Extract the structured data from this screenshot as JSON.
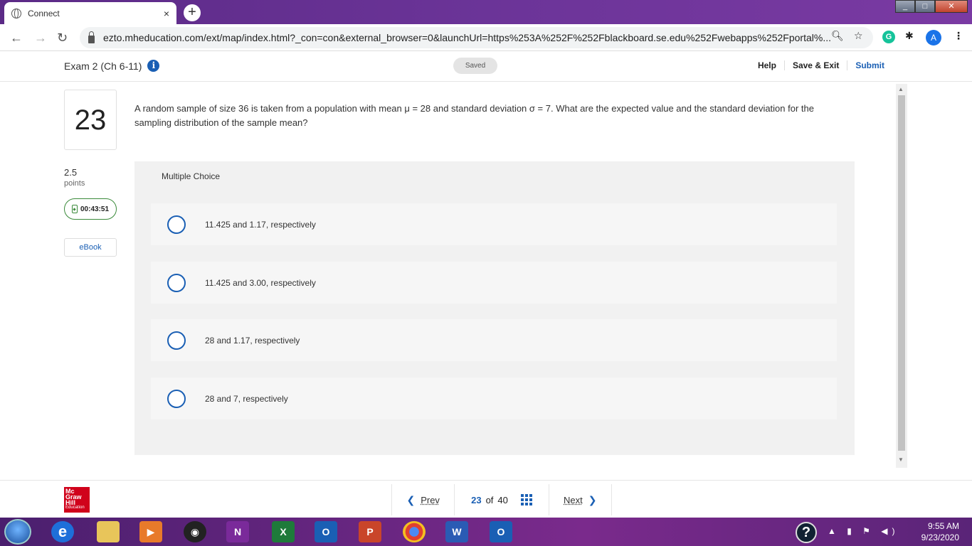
{
  "browser": {
    "tab_title": "Connect",
    "tab_close": "×",
    "new_tab": "+",
    "url": "ezto.mheducation.com/ext/map/index.html?_con=con&external_browser=0&launchUrl=https%253A%252F%252Fblackboard.se.edu%252Fwebapps%252Fportal%...",
    "avatar_letter": "A",
    "grammarly_letter": "G"
  },
  "header": {
    "exam_title": "Exam 2 (Ch 6-11)",
    "info_label": "i",
    "status": "Saved",
    "help": "Help",
    "save_exit": "Save & Exit",
    "submit": "Submit"
  },
  "question": {
    "number": "23",
    "points_value": "2.5",
    "points_label": "points",
    "timer": "00:43:51",
    "ebook": "eBook",
    "text": "A random sample of size 36 is taken from a population with mean μ = 28 and standard deviation σ = 7. What are the expected value and the standard deviation for the sampling distribution of the sample mean?",
    "type_label": "Multiple Choice",
    "options": [
      "11.425 and 1.17, respectively",
      "11.425 and 3.00, respectively",
      "28 and 1.17, respectively",
      "28 and 7, respectively"
    ]
  },
  "footer": {
    "brand_lines": [
      "Mc",
      "Graw",
      "Hill",
      "Education"
    ],
    "prev": "Prev",
    "current": "23",
    "of": "of",
    "total": "40",
    "next": "Next"
  },
  "taskbar": {
    "time": "9:55 AM",
    "date": "9/23/2020",
    "apps": [
      "N",
      "X",
      "O",
      "P",
      "W",
      "O"
    ]
  },
  "colors": {
    "accent": "#1a5fb4",
    "timer_border": "#3a8a3a",
    "brand_red": "#d0021b"
  }
}
